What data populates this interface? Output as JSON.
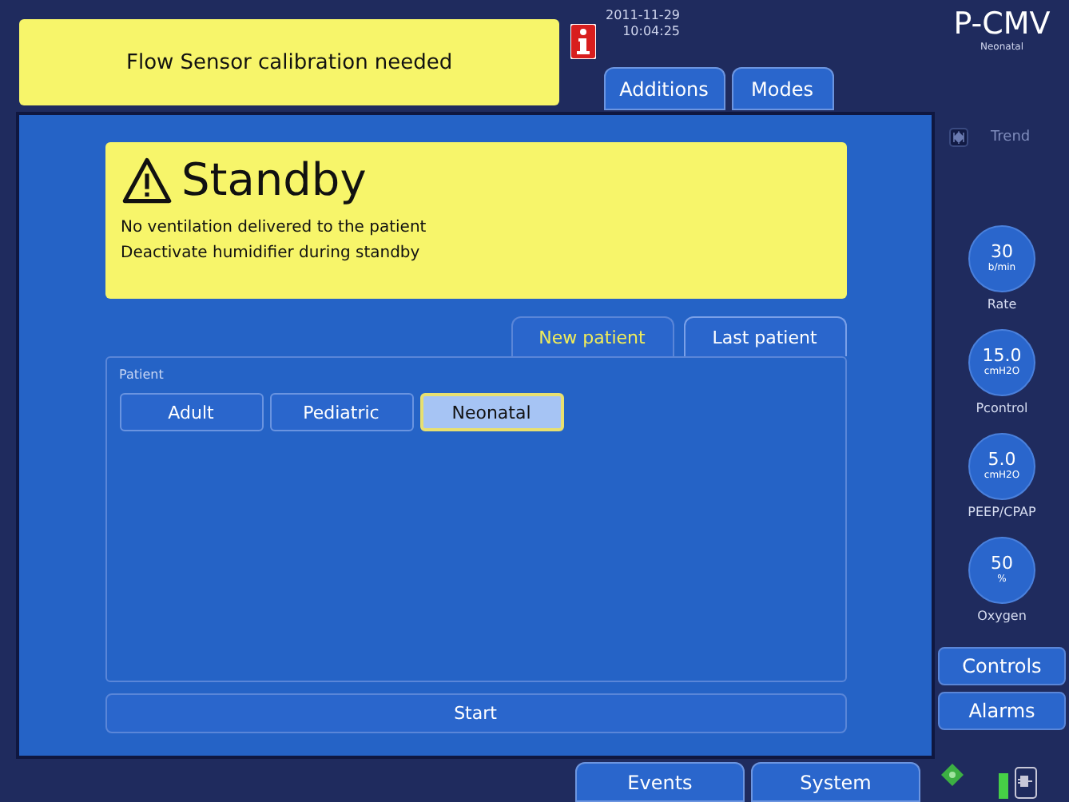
{
  "alert": {
    "message": "Flow Sensor calibration needed"
  },
  "clock": {
    "date": "2011-11-29",
    "time": "10:04:25"
  },
  "top_tabs": [
    {
      "label": "Additions",
      "selected": false
    },
    {
      "label": "Modes",
      "selected": false
    }
  ],
  "mode": {
    "title": "P-CMV",
    "subtitle": "Neonatal"
  },
  "standby": {
    "title": "Standby",
    "lines": [
      "No ventilation delivered to the patient",
      "Deactivate humidifier during standby"
    ]
  },
  "patient_tabs": [
    {
      "label": "New patient",
      "selected": true
    },
    {
      "label": "Last patient",
      "selected": false
    }
  ],
  "patient_group": {
    "label": "Patient",
    "options": [
      {
        "label": "Adult",
        "selected": false
      },
      {
        "label": "Pediatric",
        "selected": false
      },
      {
        "label": "Neonatal",
        "selected": true
      }
    ]
  },
  "start_button": "Start",
  "trend": {
    "label": "Trend",
    "disabled": true
  },
  "parameters": [
    {
      "value": "30",
      "unit": "b/min",
      "name": "Rate"
    },
    {
      "value": "15.0",
      "unit": "cmH2O",
      "name": "Pcontrol"
    },
    {
      "value": "5.0",
      "unit": "cmH2O",
      "name": "PEEP/CPAP"
    },
    {
      "value": "50",
      "unit": "%",
      "name": "Oxygen"
    }
  ],
  "side_buttons": [
    "Controls",
    "Alarms"
  ],
  "bottom_tabs": [
    {
      "label": "Events",
      "selected": false
    },
    {
      "label": "System",
      "selected": false
    }
  ]
}
